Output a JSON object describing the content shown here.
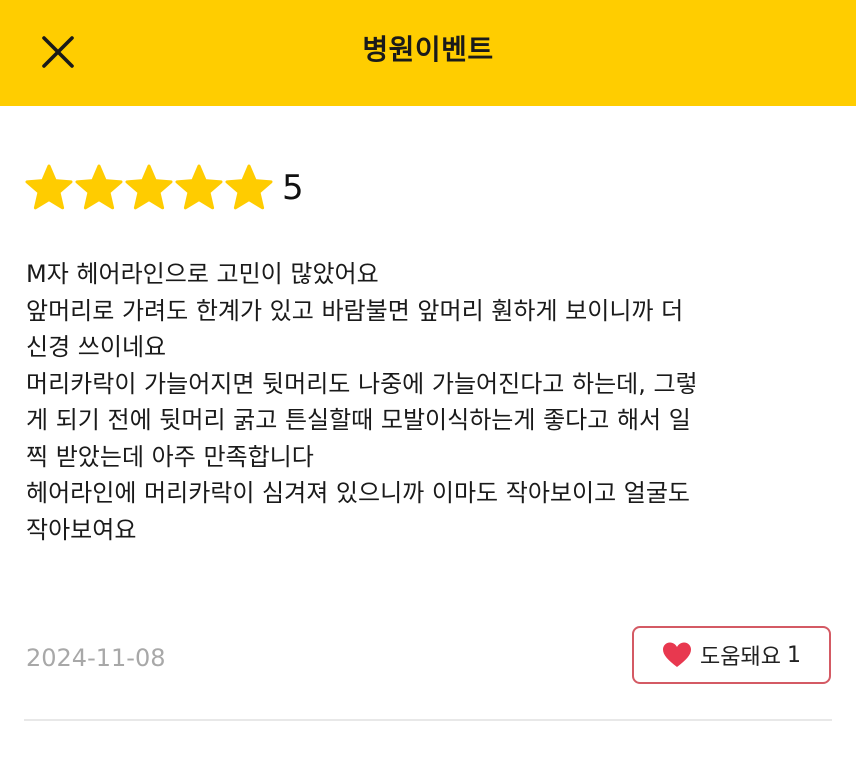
{
  "header": {
    "title": "병원이벤트",
    "close_icon": "close-icon",
    "background_color": "#ffcd00"
  },
  "review": {
    "rating": {
      "value": "5",
      "stars_filled": 5,
      "stars_total": 5,
      "star_color": "#ffcc00"
    },
    "body_lines": [
      "M자 헤어라인으로 고민이 많았어요",
      "앞머리로 가려도 한계가 있고 바람불면 앞머리 훤하게 보이니까 더",
      "신경 쓰이네요",
      "머리카락이 가늘어지면 뒷머리도 나중에 가늘어진다고 하는데, 그렇",
      "게 되기 전에 뒷머리 굵고 튼실할때 모발이식하는게 좋다고 해서 일",
      "찍 받았는데 아주 만족합니다",
      "헤어라인에 머리카락이 심겨져 있으니까 이마도 작아보이고 얼굴도",
      "작아보여요"
    ],
    "date": "2024-11-08",
    "helpful": {
      "label": "도움돼요",
      "count": "1",
      "icon": "heart-icon",
      "heart_color": "#e8384f",
      "border_color": "#d45a64"
    }
  }
}
